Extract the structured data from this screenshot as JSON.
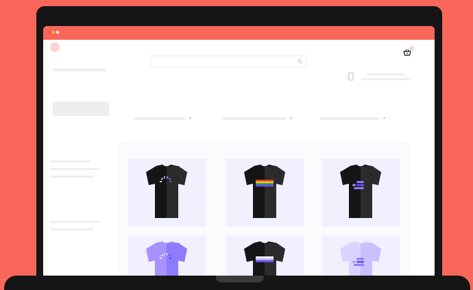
{
  "colors": {
    "background": "#f9675b",
    "laptop": "#151515",
    "titlebar": "#f9675b",
    "placeholder": "#eeeeee",
    "card_background": "#f1f0ff",
    "shirt_dark": "#151515",
    "shirt_purple": "#8f7bff",
    "shirt_lavender": "#c7c0ff"
  },
  "window": {
    "controls": [
      "close-dot",
      "minimize-dot",
      "maximize-dot"
    ]
  },
  "header": {
    "search_icon": "search-icon",
    "cart_icon": "shopping-basket-icon",
    "phone_icon": "phone-icon"
  },
  "products": [
    {
      "shirt_color": "dark",
      "print": "loading-spinner-print"
    },
    {
      "shirt_color": "dark",
      "print": "rainbow-stripes-print"
    },
    {
      "shirt_color": "dark",
      "print": "stacked-pills-print"
    },
    {
      "shirt_color": "purple",
      "print": "loading-spinner-print"
    },
    {
      "shirt_color": "dark",
      "print": "lavender-stripes-print"
    },
    {
      "shirt_color": "lavender",
      "print": "stacked-pills-print"
    }
  ]
}
